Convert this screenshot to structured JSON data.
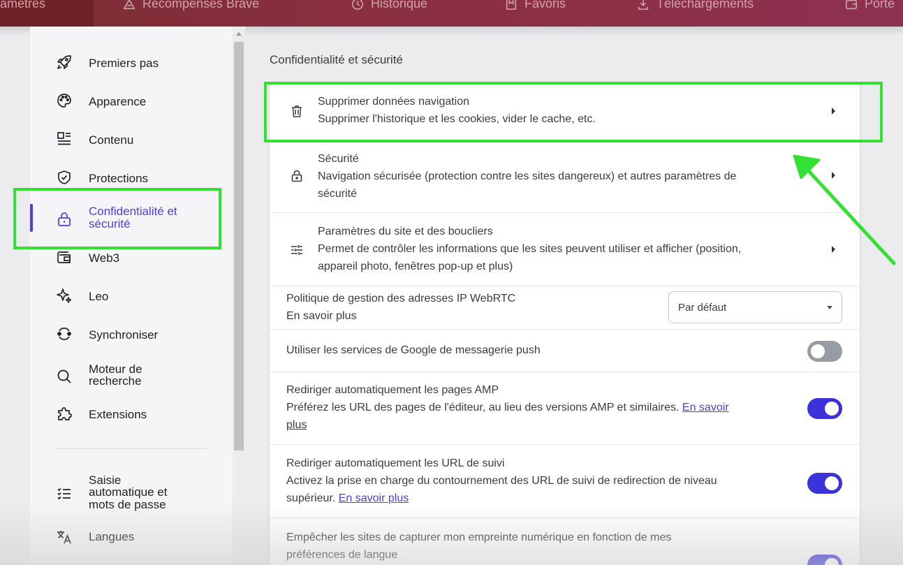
{
  "topbar": {
    "tabs": [
      {
        "label": "ramètres",
        "icon": "none"
      },
      {
        "label": "Récompenses Brave",
        "icon": "triangle-icon"
      },
      {
        "label": "Historique",
        "icon": "clock-icon"
      },
      {
        "label": "Favoris",
        "icon": "bookmark-icon"
      },
      {
        "label": "Téléchargements",
        "icon": "download-icon"
      },
      {
        "label": "Porte",
        "icon": "wallet-icon"
      }
    ]
  },
  "sidebar": {
    "items": [
      {
        "label": "Premiers pas",
        "icon": "rocket-icon"
      },
      {
        "label": "Apparence",
        "icon": "palette-icon"
      },
      {
        "label": "Contenu",
        "icon": "content-icon"
      },
      {
        "label": "Protections",
        "icon": "shield-icon"
      },
      {
        "label_line1": "Confidentialité et",
        "label_line2": "sécurité",
        "icon": "lock-icon",
        "active": true
      },
      {
        "label": "Web3",
        "icon": "wallet-icon"
      },
      {
        "label": "Leo",
        "icon": "sparkle-icon"
      },
      {
        "label": "Synchroniser",
        "icon": "sync-icon"
      },
      {
        "label_line1": "Moteur de",
        "label_line2": "recherche",
        "icon": "search-icon"
      },
      {
        "label": "Extensions",
        "icon": "puzzle-icon"
      },
      {
        "label_line1": "Saisie",
        "label_line2": "automatique et",
        "label_line3": "mots de passe",
        "icon": "list-icon"
      },
      {
        "label": "Langues",
        "icon": "translate-icon"
      }
    ]
  },
  "main": {
    "section_title": "Confidentialité et sécurité",
    "rows": {
      "clear": {
        "title": "Supprimer données navigation",
        "subtitle": "Supprimer l'historique et les cookies, vider le cache, etc."
      },
      "security": {
        "title": "Sécurité",
        "subtitle_line1": "Navigation sécurisée (protection contre les sites dangereux) et autres paramètres de",
        "subtitle_line2": "sécurité"
      },
      "site": {
        "title": "Paramètres du site et des boucliers",
        "subtitle_line1": "Permet de contrôler les informations que les sites peuvent utiliser et afficher (position,",
        "subtitle_line2": "appareil photo, fenêtres pop-up et plus)"
      },
      "webrtc": {
        "title": "Politique de gestion des adresses IP WebRTC",
        "link": "En savoir plus",
        "select_value": "Par défaut"
      },
      "push": {
        "title": "Utiliser les services de Google de messagerie push",
        "enabled": false
      },
      "amp": {
        "title": "Rediriger automatiquement les pages AMP",
        "subtitle": "Préférez les URL des pages de l'éditeur, au lieu des versions AMP et similaires.",
        "link_part1": "En savoir",
        "link_part2": "plus",
        "enabled": true
      },
      "tracking": {
        "title": "Rediriger automatiquement les URL de suivi",
        "subtitle_line1": "Activez la prise en charge du contournement des URL de suivi de redirection de niveau",
        "subtitle_line2": "supérieur.",
        "link": "En savoir plus",
        "enabled": true
      },
      "fingerprint": {
        "title_line1": "Empêcher les sites de capturer mon empreinte numérique en fonction de mes",
        "title_line2": "préférences de langue",
        "enabled": true
      }
    }
  },
  "colors": {
    "accent": "#4c40e0",
    "toggle_on": "#3b33d9",
    "toggle_off": "#979ca3",
    "annotation": "#33e033",
    "topbar": "#8a2f40"
  }
}
